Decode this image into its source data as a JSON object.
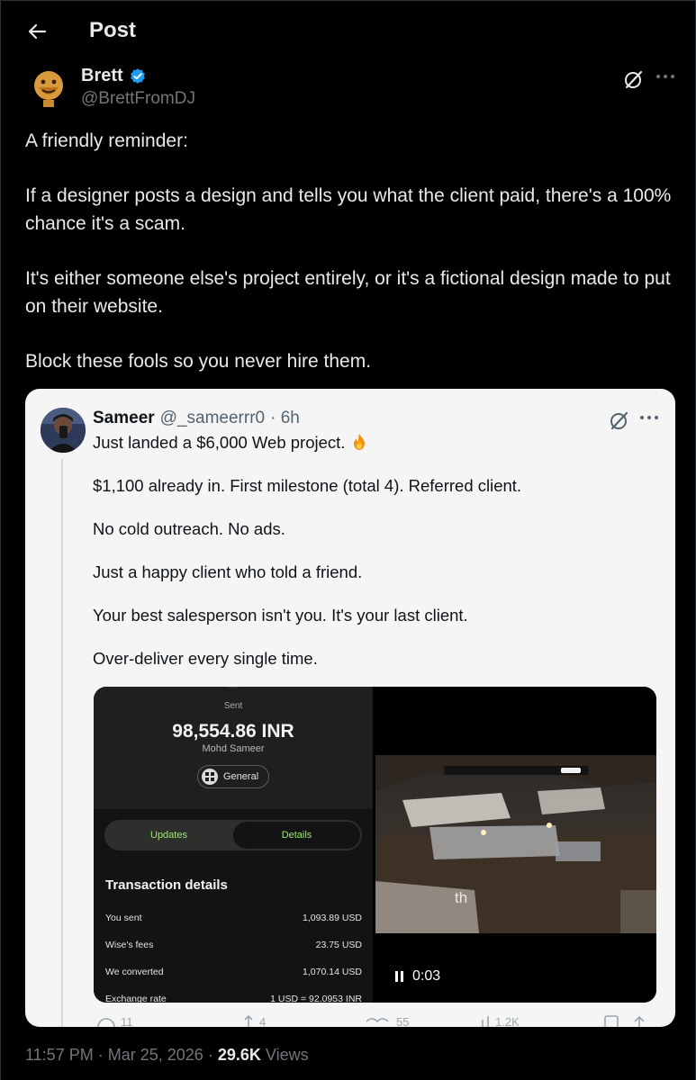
{
  "header": {
    "title": "Post"
  },
  "author": {
    "name": "Brett",
    "handle": "@BrettFromDJ"
  },
  "post": {
    "paragraphs": [
      "A friendly reminder:",
      "If a designer posts a design and tells you what the client paid, there's a 100% chance it's a scam.",
      "It's either someone else's project entirely, or it's a fictional design made to put on their website.",
      "Block these fools so you never hire them."
    ],
    "time": "11:57 PM",
    "date": "Mar 25, 2026",
    "separator": "·",
    "views_count": "29.6K",
    "views_label": "Views"
  },
  "quote": {
    "name": "Sameer",
    "handle": "@_sameerrr0",
    "age": "· 6h",
    "first_line": "Just landed a $6,000 Web project.",
    "paragraphs": [
      "$1,100 already in. First milestone (total 4). Referred client.",
      "No cold outreach. No ads.",
      "Just a happy client who told a friend.",
      "Your best salesperson isn't you. It's your last client.",
      "Over-deliver every single time."
    ],
    "wise": {
      "sent_label": "Sent",
      "amount": "98,554.86 INR",
      "recipient": "Mohd Sameer",
      "chip": "General",
      "tab_updates": "Updates",
      "tab_details": "Details",
      "section_title": "Transaction details",
      "rows": [
        {
          "label": "You sent",
          "value": "1,093.89 USD"
        },
        {
          "label": "Wise's fees",
          "value": "23.75 USD"
        },
        {
          "label": "We converted",
          "value": "1,070.14 USD"
        },
        {
          "label": "Exchange rate",
          "value": "1 USD = 92.0953 INR"
        }
      ]
    },
    "video": {
      "overlay_text": "th",
      "time": "0:03"
    },
    "action_counts": [
      "11",
      "4",
      "55",
      "1.2K"
    ]
  },
  "colors": {
    "background": "#000000",
    "text": "#e7e9ea",
    "muted": "#71767b",
    "verified": "#1d9bf0",
    "card": "#f5f5f5",
    "wise_green": "#9fe870"
  },
  "icons": {
    "back": "arrow-left-icon",
    "verified": "verified-badge-icon",
    "grok": "grok-icon",
    "more": "more-icon",
    "fire": "fire-emoji-icon",
    "pause": "pause-icon"
  }
}
